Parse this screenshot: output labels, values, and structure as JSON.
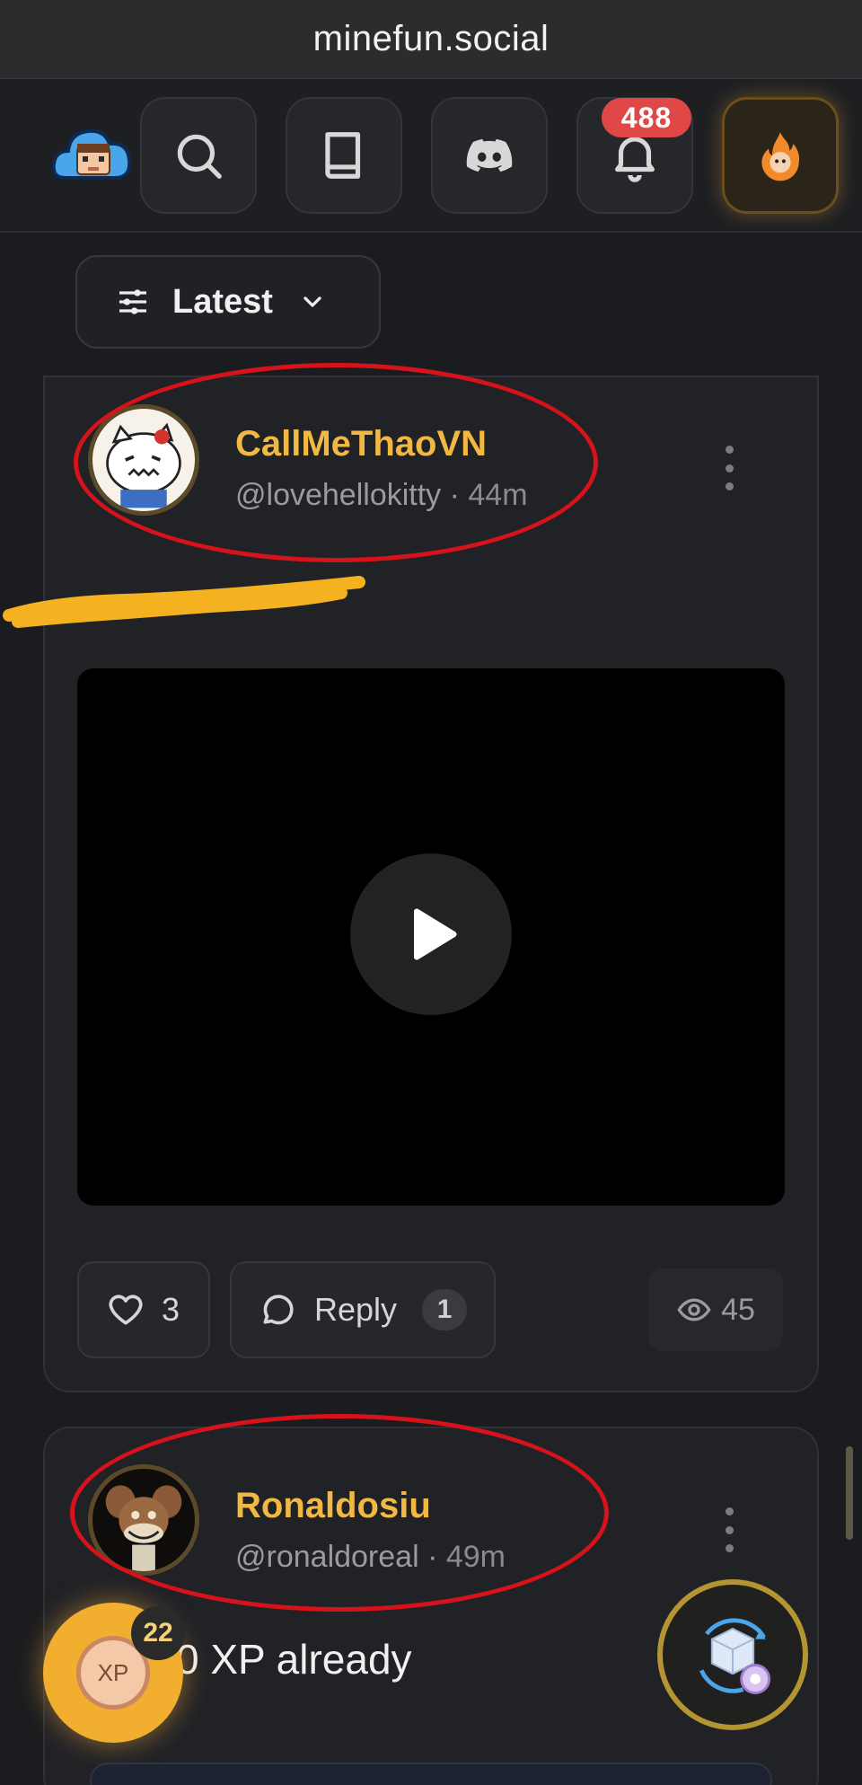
{
  "browser": {
    "url": "minefun.social"
  },
  "nav": {
    "logo_icon": "cloud-face-logo",
    "buttons": [
      "search-icon",
      "book-icon",
      "discord-icon",
      "bell-icon",
      "flame-avatar-icon"
    ],
    "notification_count": "488"
  },
  "filter": {
    "label": "Latest"
  },
  "posts": [
    {
      "display_name": "CallMeThaoVN",
      "handle": "@lovehellokitty",
      "time": "44m",
      "likes": "3",
      "reply_label": "Reply",
      "reply_count": "1",
      "views": "45"
    },
    {
      "display_name": "Ronaldosiu",
      "handle": "@ronaldoreal",
      "time": "49m",
      "text": "0 XP already"
    }
  ],
  "xp": {
    "label": "XP",
    "count": "22"
  },
  "colors": {
    "accent": "#f2b844",
    "annotation": "#d6121a",
    "badge": "#e04848"
  }
}
